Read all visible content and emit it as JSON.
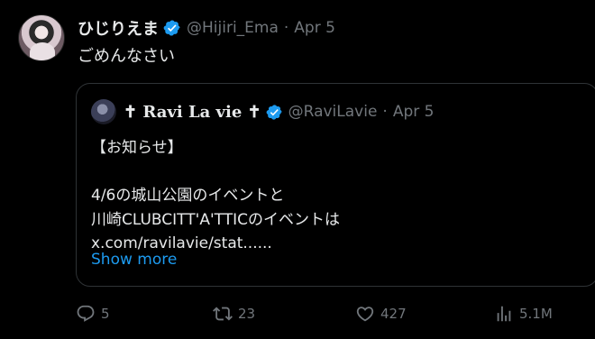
{
  "tweet": {
    "display_name": "ひじりえま",
    "handle": "@Hijiri_Ema",
    "separator": "·",
    "date": "Apr 5",
    "text": "ごめんなさい"
  },
  "quote": {
    "display_name": "✝ Ravi La vie ✝",
    "handle": "@RaviLavie",
    "separator": "·",
    "date": "Apr 5",
    "text": "【お知らせ】\n\n4/6の城山公園のイベントと\n川崎CLUBCITT'A'TTICのイベントは\nx.com/ravilavie/stat......",
    "show_more": "Show more"
  },
  "actions": {
    "replies": "5",
    "reposts": "23",
    "likes": "427",
    "views": "5.1M"
  },
  "colors": {
    "accent": "#1d9bf0",
    "muted": "#71767b",
    "text": "#e7e9ea",
    "border": "#2f3336",
    "background": "#000000"
  },
  "icons": [
    "verified-badge-icon",
    "reply-icon",
    "repost-icon",
    "like-icon",
    "views-icon"
  ]
}
